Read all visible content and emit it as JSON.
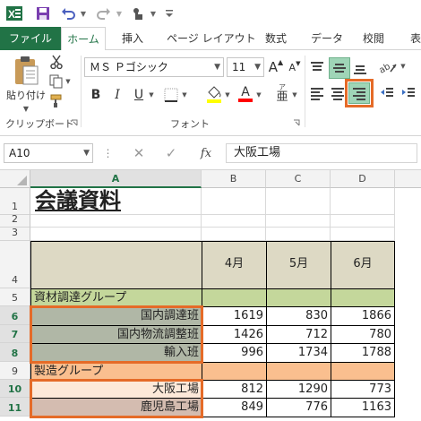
{
  "qat": {
    "excel_icon": "excel-icon",
    "save_icon": "save-icon",
    "undo_icon": "undo-icon",
    "redo_icon": "redo-icon",
    "touch_icon": "touch-mode-icon",
    "customize_icon": "customize-qat-icon"
  },
  "tabs": [
    {
      "label": "ファイル"
    },
    {
      "label": "ホーム"
    },
    {
      "label": "挿入"
    },
    {
      "label": "ページ レイアウト"
    },
    {
      "label": "数式"
    },
    {
      "label": "データ"
    },
    {
      "label": "校閲"
    },
    {
      "label": "表"
    }
  ],
  "ribbon": {
    "clipboard": {
      "paste_label": "貼り付け",
      "group_label": "クリップボード"
    },
    "font": {
      "font_name": "ＭＳ Ｐゴシック",
      "font_size": "11",
      "group_label": "フォント",
      "grow_glyph": "A",
      "shrink_glyph": "A",
      "bold": "B",
      "italic": "I",
      "underline": "U",
      "font_color_glyph": "A",
      "phonetic_glyph": "亜"
    },
    "alignment": {
      "orientation_glyph": "ab"
    }
  },
  "formula_bar": {
    "name_box": "A10",
    "fx": "fx",
    "content": "大阪工場"
  },
  "grid": {
    "columns": [
      "A",
      "B",
      "C",
      "D"
    ],
    "rows": [
      "1",
      "2",
      "3",
      "4",
      "5",
      "6",
      "7",
      "8",
      "9",
      "10",
      "11"
    ],
    "title": "会議資料",
    "months": [
      "4月",
      "5月",
      "6月"
    ],
    "group1": "資材調達グループ",
    "group1_rows": [
      {
        "name": "国内調達班",
        "values": [
          "1619",
          "830",
          "1866"
        ]
      },
      {
        "name": "国内物流調整班",
        "values": [
          "1426",
          "712",
          "780"
        ]
      },
      {
        "name": "輸入班",
        "values": [
          "996",
          "1734",
          "1788"
        ]
      }
    ],
    "group2": "製造グループ",
    "group2_rows": [
      {
        "name": "大阪工場",
        "values": [
          "812",
          "1290",
          "773"
        ]
      },
      {
        "name": "鹿児島工場",
        "values": [
          "849",
          "776",
          "1163"
        ]
      }
    ]
  },
  "colors": {
    "accent": "#217346",
    "highlight": "#e56b28",
    "header_fill": "#ddd9c4",
    "group1_fill": "#c4d79b",
    "group1_item_fill": "#b0b7a6",
    "group2_fill": "#fabf8f",
    "group2_item_fill_1": "#fde9d9",
    "group2_item_fill_2": "#d4bcb0"
  }
}
